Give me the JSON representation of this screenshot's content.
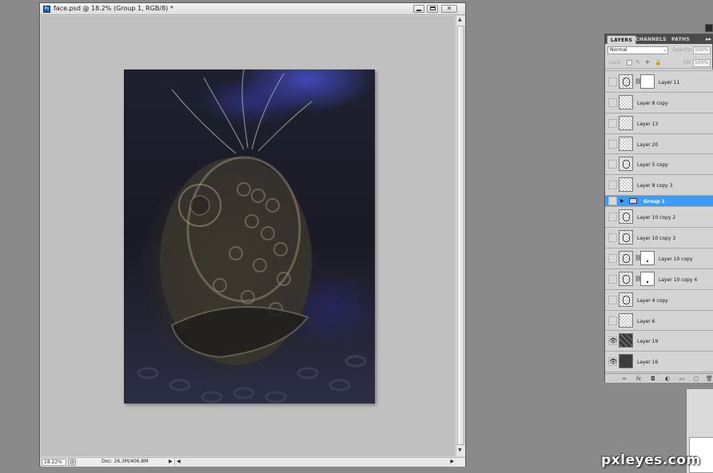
{
  "document": {
    "app_icon_label": "Ps",
    "title": "face.psd @ 18.2% (Group 1, RGB/8) *",
    "minimize_glyph": "▁",
    "restore_glyph": "□",
    "close_glyph": "✕",
    "scroll_up": "▲",
    "scroll_down": "▼",
    "scroll_left": "◀",
    "scroll_right": "▶"
  },
  "statusbar": {
    "zoom": "18.22%",
    "doc_size": "Doc: 26.3M/406.8M",
    "menu_arrow": "▶"
  },
  "layers_panel": {
    "tabs": [
      "LAYERS",
      "CHANNELS",
      "PATHS"
    ],
    "menu_glyph": "▸▸",
    "blend_mode": "Normal",
    "opacity_label": "Opacity:",
    "opacity_value": "100%",
    "lock_label": "Lock:",
    "fill_label": "Fill:",
    "fill_value": "100%",
    "layers": [
      {
        "name": "Layer 11",
        "visible": false,
        "has_mask": true
      },
      {
        "name": "Layer 8 copy",
        "visible": false,
        "has_mask": false
      },
      {
        "name": "Layer 13",
        "visible": false,
        "has_mask": false
      },
      {
        "name": "Layer 20",
        "visible": false,
        "has_mask": false
      },
      {
        "name": "Layer 5 copy",
        "visible": false,
        "has_mask": false
      },
      {
        "name": "Layer 8 copy 3",
        "visible": false,
        "has_mask": false
      },
      {
        "name": "Group 1",
        "visible": false,
        "is_group": true,
        "selected": true
      },
      {
        "name": "Layer 10 copy 2",
        "visible": false,
        "has_mask": false
      },
      {
        "name": "Layer 10 copy 3",
        "visible": false,
        "has_mask": false
      },
      {
        "name": "Layer 10 copy",
        "visible": false,
        "has_mask": true
      },
      {
        "name": "Layer 10 copy 4",
        "visible": false,
        "has_mask": true
      },
      {
        "name": "Layer 4 copy",
        "visible": false,
        "has_mask": false
      },
      {
        "name": "Layer 6",
        "visible": false,
        "has_mask": false
      },
      {
        "name": "Layer 19",
        "visible": true,
        "has_mask": false
      },
      {
        "name": "Layer 16",
        "visible": true,
        "has_mask": false
      }
    ],
    "eye_glyph": "👁",
    "footer_icons": [
      "link-icon",
      "fx-icon",
      "mask-icon",
      "adjustment-icon",
      "folder-icon",
      "new-layer-icon",
      "trash-icon"
    ],
    "footer_glyphs": [
      "∞",
      "fx",
      "◘",
      "◐",
      "▭",
      "▢",
      "🗑"
    ]
  },
  "watermark": "pxleyes.com"
}
